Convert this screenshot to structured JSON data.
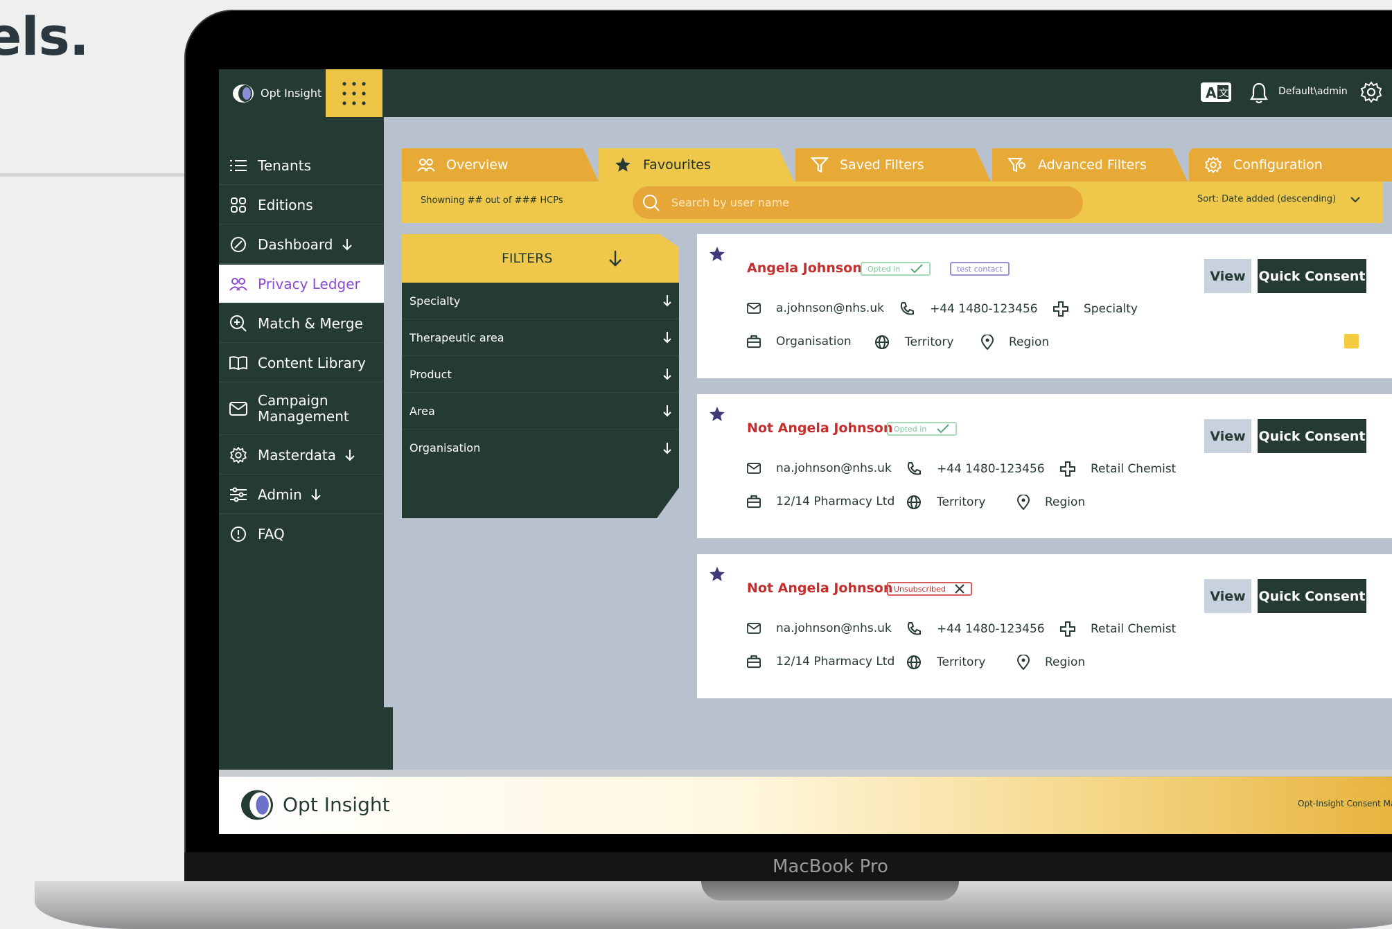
{
  "marketing": {
    "headline": "els."
  },
  "device": {
    "brand": "MacBook Pro"
  },
  "app": {
    "name": "Opt Insight",
    "brand_colors": {
      "dark": "#253a32",
      "yellow": "#efc84b",
      "orange": "#e7aa36",
      "accent_purple": "#8a4bd0",
      "name_red": "#c62d2d"
    }
  },
  "topbar": {
    "translate_icon": "translate-icon",
    "bell_icon": "bell-icon",
    "user": "Default\\admin",
    "settings_icon": "gear-icon"
  },
  "sidebar": {
    "items": [
      {
        "label": "Tenants",
        "icon": "list-icon",
        "has_arrow": false
      },
      {
        "label": "Editions",
        "icon": "grid-icon",
        "has_arrow": false
      },
      {
        "label": "Dashboard",
        "icon": "gauge-icon",
        "has_arrow": true
      },
      {
        "label": "Privacy Ledger",
        "icon": "users-icon",
        "has_arrow": false,
        "active": true
      },
      {
        "label": "Match & Merge",
        "icon": "zoom-plus-icon",
        "has_arrow": false
      },
      {
        "label": "Content Library",
        "icon": "book-icon",
        "has_arrow": false
      },
      {
        "label": "Campaign Management",
        "icon": "mail-icon",
        "has_arrow": false
      },
      {
        "label": "Masterdata",
        "icon": "gear-icon",
        "has_arrow": true
      },
      {
        "label": "Admin",
        "icon": "sliders-icon",
        "has_arrow": true
      },
      {
        "label": "FAQ",
        "icon": "info-icon",
        "has_arrow": false
      }
    ]
  },
  "tabs": [
    {
      "label": "Overview",
      "icon": "users-icon"
    },
    {
      "label": "Favourites",
      "icon": "star-icon",
      "active": true
    },
    {
      "label": "Saved Filters",
      "icon": "filter-icon"
    },
    {
      "label": "Advanced Filters",
      "icon": "filter-settings-icon"
    },
    {
      "label": "Configuration",
      "icon": "gear-icon"
    }
  ],
  "subbar": {
    "count_text": "Showning ## out of ### HCPs",
    "search_placeholder": "Search by user name",
    "sort_label": "Sort: Date added (descending)"
  },
  "filters": {
    "title": "FILTERS",
    "items": [
      "Specialty",
      "Therapeutic area",
      "Product",
      "Area",
      "Organisation"
    ]
  },
  "cards": [
    {
      "name": "Angela Johnson",
      "badges": [
        {
          "label": "Opted in",
          "status": "opted-in"
        },
        {
          "label": "test contact",
          "status": "tag"
        }
      ],
      "email": "a.johnson@nhs.uk",
      "phone": "+44 1480-123456",
      "specialty": "Specialty",
      "organisation": "Organisation",
      "territory": "Territory",
      "region": "Region",
      "has_note": true,
      "view_label": "View",
      "consent_label": "Quick Consent"
    },
    {
      "name": "Not Angela Johnson",
      "badges": [
        {
          "label": "Opted in",
          "status": "opted-in"
        }
      ],
      "email": "na.johnson@nhs.uk",
      "phone": "+44 1480-123456",
      "specialty": "Retail Chemist",
      "organisation": "12/14 Pharmacy Ltd",
      "territory": "Territory",
      "region": "Region",
      "has_note": false,
      "view_label": "View",
      "consent_label": "Quick Consent"
    },
    {
      "name": "Not Angela Johnson",
      "badges": [
        {
          "label": "Unsubscribed",
          "status": "unsubscribed"
        }
      ],
      "email": "na.johnson@nhs.uk",
      "phone": "+44 1480-123456",
      "specialty": "Retail Chemist",
      "organisation": "12/14 Pharmacy Ltd",
      "territory": "Territory",
      "region": "Region",
      "has_note": false,
      "view_label": "View",
      "consent_label": "Quick Consent"
    }
  ],
  "footer": {
    "brand": "Opt Insight",
    "right_text": "Opt-Insight Consent Ma"
  }
}
